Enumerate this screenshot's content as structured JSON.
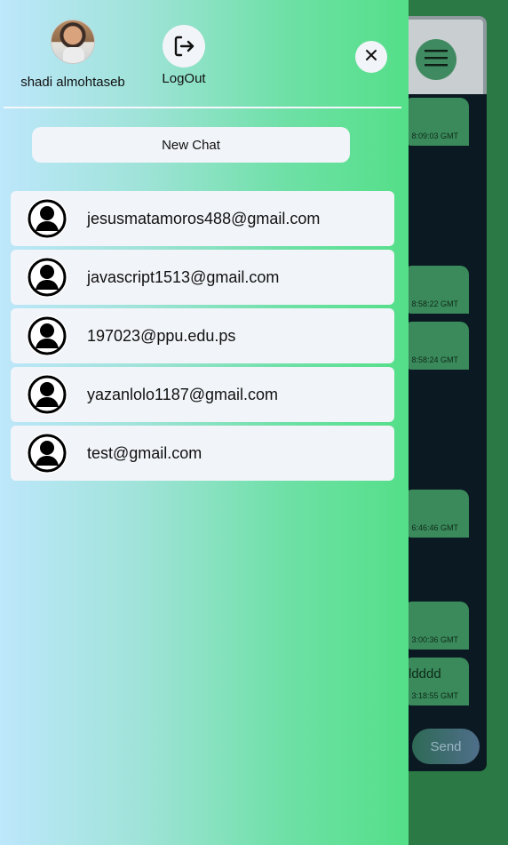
{
  "drawer": {
    "user": {
      "name": "shadi almohtaseb",
      "avatar_icon": "user-photo"
    },
    "logout": {
      "label": "LogOut",
      "icon": "logout-icon"
    },
    "close_icon": "close-icon",
    "new_chat_label": "New Chat",
    "contacts": [
      {
        "email": "jesusmatamoros488@gmail.com",
        "icon": "user-circle-icon"
      },
      {
        "email": "javascript1513@gmail.com",
        "icon": "user-circle-icon"
      },
      {
        "email": "197023@ppu.edu.ps",
        "icon": "user-circle-icon"
      },
      {
        "email": "yazanlolo1187@gmail.com",
        "icon": "user-circle-icon"
      },
      {
        "email": "test@gmail.com",
        "icon": "user-circle-icon"
      }
    ]
  },
  "chat": {
    "menu_icon": "hamburger-menu-icon",
    "messages": [
      {
        "text": "",
        "time": "8:09:03 GMT"
      },
      {
        "text": "",
        "time": "8:58:22 GMT"
      },
      {
        "text": "",
        "time": "8:58:24 GMT"
      },
      {
        "text": "",
        "time": "6:46:46 GMT"
      },
      {
        "text": "",
        "time": "3:00:36 GMT"
      },
      {
        "text": "ldddd",
        "time": "3:18:55 GMT"
      }
    ],
    "send_label": "Send"
  },
  "colors": {
    "drawer_gradient_start": "#bde7fb",
    "drawer_gradient_end": "#54df88",
    "panel_bg": "#f1f4f8",
    "chat_bg": "#0b1a22",
    "app_bg": "#2b7a45",
    "message_bubble": "#3b8a5c"
  }
}
